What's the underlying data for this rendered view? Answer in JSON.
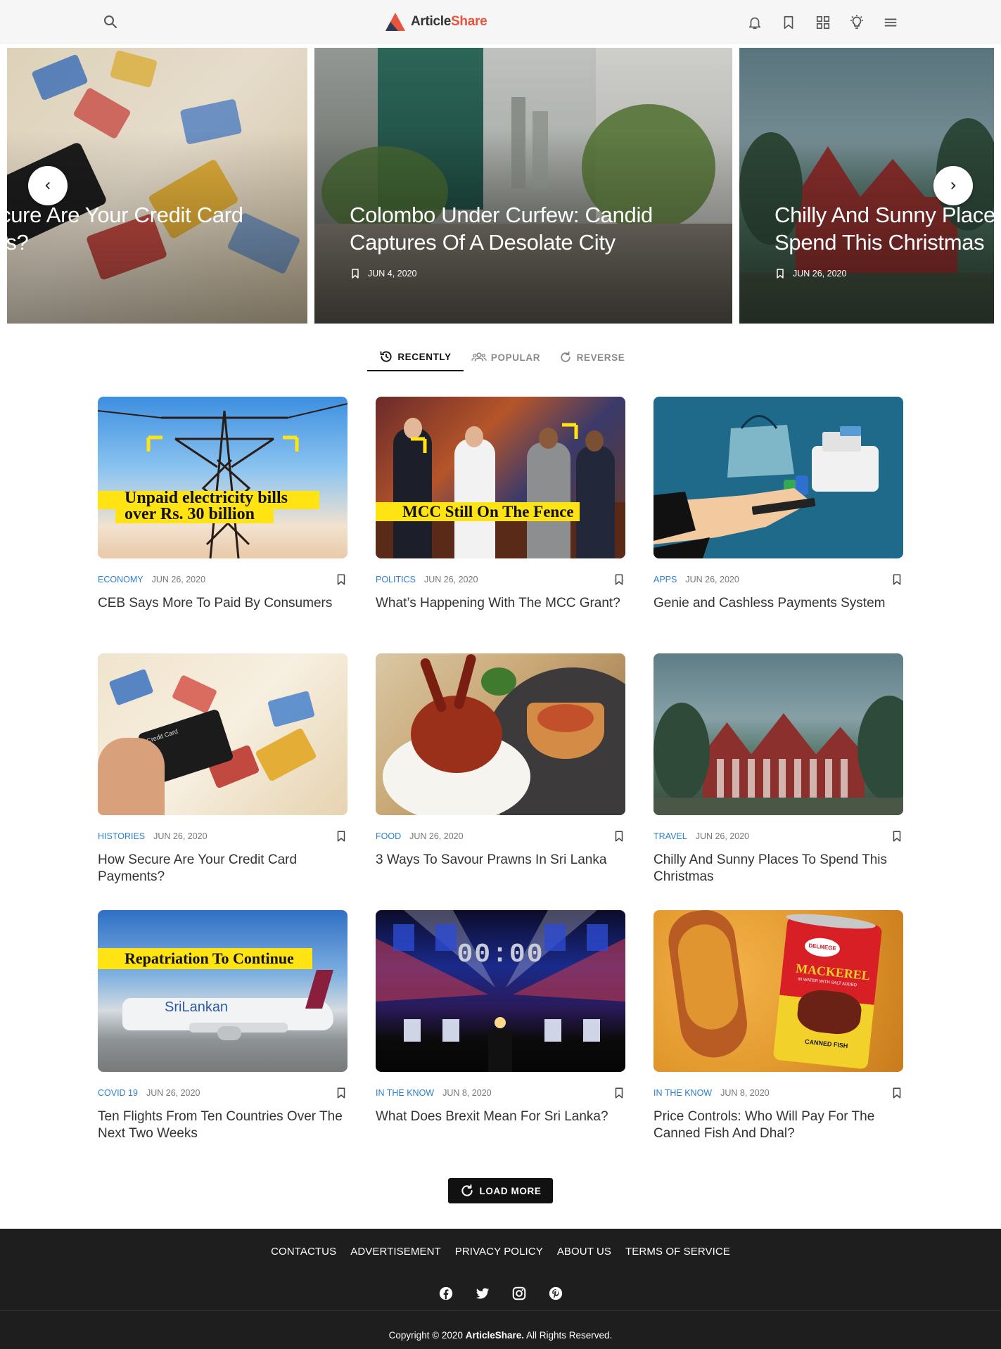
{
  "header": {
    "brand_part1": "Article",
    "brand_part2": "Share",
    "icons": [
      "search-icon",
      "bell-icon",
      "bookmark-icon",
      "grid-icon",
      "lightbulb-icon",
      "menu-icon"
    ]
  },
  "carousel": {
    "slides": [
      {
        "title": "How Secure Are Your Credit Card Payments?",
        "title_visible": "cure Are Your Credit Card\nts?",
        "date": ""
      },
      {
        "title": "Colombo Under Curfew: Candid Captures Of A Desolate City",
        "date": "JUN 4, 2020"
      },
      {
        "title": "Chilly And Sunny Places To Spend This Christmas",
        "title_visible": "Chilly And Sunny Place\nSpend This Christmas",
        "date": "JUN 26, 2020"
      }
    ]
  },
  "tabs": [
    {
      "label": "RECENTLY",
      "icon": "history-icon",
      "active": true
    },
    {
      "label": "POPULAR",
      "icon": "people-icon",
      "active": false
    },
    {
      "label": "REVERSE",
      "icon": "refresh-icon",
      "active": false
    }
  ],
  "articles": [
    {
      "category": "ECONOMY",
      "date": "JUN 26, 2020",
      "title": "CEB Says More To Paid By Consumers",
      "overlay": "Unpaid electricity bills\nover Rs. 30 billion"
    },
    {
      "category": "POLITICS",
      "date": "JUN 26, 2020",
      "title": "What’s Happening With The MCC Grant?",
      "overlay": "MCC Still On The Fence"
    },
    {
      "category": "APPS",
      "date": "JUN 26, 2020",
      "title": "Genie and Cashless Payments System",
      "overlay": ""
    },
    {
      "category": "HISTORIES",
      "date": "JUN 26, 2020",
      "title": "How Secure Are Your Credit Card Payments?",
      "overlay": ""
    },
    {
      "category": "FOOD",
      "date": "JUN 26, 2020",
      "title": "3 Ways To Savour Prawns In Sri Lanka",
      "overlay": ""
    },
    {
      "category": "TRAVEL",
      "date": "JUN 26, 2020",
      "title": "Chilly And Sunny Places To Spend This Christmas",
      "overlay": ""
    },
    {
      "category": "COVID 19",
      "date": "JUN 26, 2020",
      "title": "Ten Flights From Ten Countries Over The Next Two Weeks",
      "overlay": "Repatriation To Continue"
    },
    {
      "category": "IN THE KNOW",
      "date": "JUN 8, 2020",
      "title": "What Does Brexit Mean For Sri Lanka?",
      "overlay": "00:00"
    },
    {
      "category": "IN THE KNOW",
      "date": "JUN 8, 2020",
      "title": "Price Controls: Who Will Pay For The Canned Fish And Dhal?",
      "overlay": "MACKEREL"
    }
  ],
  "image_text": {
    "srilankan": "SriLankan",
    "delmege": "DELMEGE",
    "can_sub": "IN WATER WITH SALT ADDED",
    "canned_fish": "CANNED FISH",
    "credit_card": "Credit Card"
  },
  "load_more": "LOAD MORE",
  "footer": {
    "links": [
      "CONTACTUS",
      "ADVERTISEMENT",
      "PRIVACY POLICY",
      "ABOUT US",
      "TERMS OF SERVICE"
    ],
    "socials": [
      "facebook-icon",
      "twitter-icon",
      "instagram-icon",
      "pinterest-icon"
    ],
    "copyright_prefix": "Copyright © 2020",
    "copyright_brand": "ArticleShare.",
    "copyright_suffix": "All Rights Reserved."
  },
  "colors": {
    "accent": "#e8543d",
    "category": "#2d7fd0",
    "footer_bg": "#1e1e1e",
    "header_bg": "#f6f6f6",
    "highlight_yellow": "#ffe312"
  }
}
